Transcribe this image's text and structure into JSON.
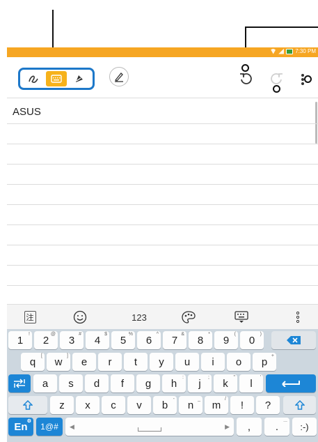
{
  "status_bar": {
    "time": "7:30 PM",
    "background": "#f6a623"
  },
  "toolbar": {
    "mode_buttons": [
      {
        "icon": "handwriting-icon",
        "active": false
      },
      {
        "icon": "keyboard-icon",
        "active": true
      },
      {
        "icon": "draw-icon",
        "active": false
      }
    ],
    "highlight_color": "#1d78c9",
    "active_color": "#f6b21b"
  },
  "note": {
    "text": "ASUS"
  },
  "keyboard": {
    "top_bar": {
      "handwriting_label": "注",
      "numbers_label": "123"
    },
    "row1": [
      {
        "label": "1",
        "sub": "!"
      },
      {
        "label": "2",
        "sub": "@"
      },
      {
        "label": "3",
        "sub": "#"
      },
      {
        "label": "4",
        "sub": "$"
      },
      {
        "label": "5",
        "sub": "%"
      },
      {
        "label": "6",
        "sub": "^"
      },
      {
        "label": "7",
        "sub": "&"
      },
      {
        "label": "8",
        "sub": "*"
      },
      {
        "label": "9",
        "sub": "("
      },
      {
        "label": "0",
        "sub": ")"
      }
    ],
    "row2": [
      {
        "label": "q",
        "sub": "["
      },
      {
        "label": "w",
        "sub": "]"
      },
      {
        "label": "e",
        "sub": ""
      },
      {
        "label": "r",
        "sub": ""
      },
      {
        "label": "t",
        "sub": ""
      },
      {
        "label": "y",
        "sub": ""
      },
      {
        "label": "u",
        "sub": ""
      },
      {
        "label": "i",
        "sub": ""
      },
      {
        "label": "o",
        "sub": ""
      },
      {
        "label": "p",
        "sub": "+"
      }
    ],
    "row3": [
      {
        "label": "a",
        "sub": ""
      },
      {
        "label": "s",
        "sub": ""
      },
      {
        "label": "d",
        "sub": ""
      },
      {
        "label": "f",
        "sub": ""
      },
      {
        "label": "g",
        "sub": ""
      },
      {
        "label": "h",
        "sub": ":"
      },
      {
        "label": "j",
        "sub": ";"
      },
      {
        "label": "k",
        "sub": "\""
      },
      {
        "label": "l",
        "sub": "'"
      }
    ],
    "row4": [
      {
        "label": "z",
        "sub": ""
      },
      {
        "label": "x",
        "sub": ""
      },
      {
        "label": "c",
        "sub": ""
      },
      {
        "label": "v",
        "sub": ""
      },
      {
        "label": "b",
        "sub": "-"
      },
      {
        "label": "n",
        "sub": "_"
      },
      {
        "label": "m",
        "sub": "/"
      },
      {
        "label": "!",
        "sub": ""
      },
      {
        "label": "?",
        "sub": ""
      }
    ],
    "lang_label": "En",
    "symbols_label": "1@#",
    "comma_label": ",",
    "period_label": ".",
    "period_sub": "...",
    "emoticon_label": ":-)",
    "accent_color": "#1d86d6"
  }
}
